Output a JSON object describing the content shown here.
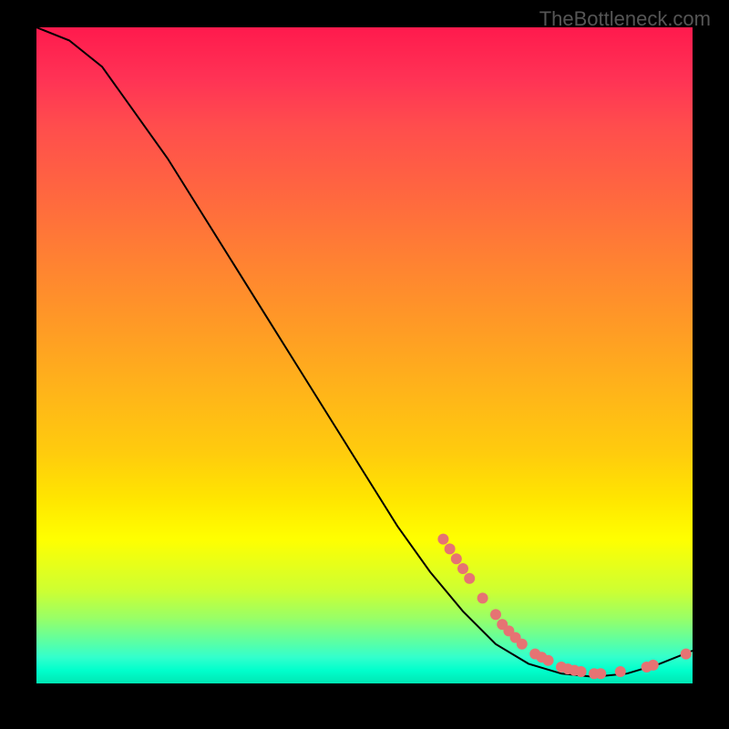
{
  "watermark": "TheBottleneck.com",
  "chart_data": {
    "type": "line",
    "title": "",
    "xlabel": "",
    "ylabel": "",
    "xlim": [
      0,
      100
    ],
    "ylim": [
      0,
      100
    ],
    "curve": [
      {
        "x": 0,
        "y": 100
      },
      {
        "x": 5,
        "y": 98
      },
      {
        "x": 10,
        "y": 94
      },
      {
        "x": 15,
        "y": 87
      },
      {
        "x": 20,
        "y": 80
      },
      {
        "x": 25,
        "y": 72
      },
      {
        "x": 30,
        "y": 64
      },
      {
        "x": 35,
        "y": 56
      },
      {
        "x": 40,
        "y": 48
      },
      {
        "x": 45,
        "y": 40
      },
      {
        "x": 50,
        "y": 32
      },
      {
        "x": 55,
        "y": 24
      },
      {
        "x": 60,
        "y": 17
      },
      {
        "x": 65,
        "y": 11
      },
      {
        "x": 70,
        "y": 6
      },
      {
        "x": 75,
        "y": 3
      },
      {
        "x": 80,
        "y": 1.5
      },
      {
        "x": 85,
        "y": 1
      },
      {
        "x": 90,
        "y": 1.5
      },
      {
        "x": 95,
        "y": 3
      },
      {
        "x": 100,
        "y": 5
      }
    ],
    "data_points": [
      {
        "x": 62,
        "y": 22
      },
      {
        "x": 63,
        "y": 20.5
      },
      {
        "x": 64,
        "y": 19
      },
      {
        "x": 65,
        "y": 17.5
      },
      {
        "x": 66,
        "y": 16
      },
      {
        "x": 68,
        "y": 13
      },
      {
        "x": 70,
        "y": 10.5
      },
      {
        "x": 71,
        "y": 9
      },
      {
        "x": 72,
        "y": 8
      },
      {
        "x": 73,
        "y": 7
      },
      {
        "x": 74,
        "y": 6
      },
      {
        "x": 76,
        "y": 4.5
      },
      {
        "x": 77,
        "y": 4
      },
      {
        "x": 78,
        "y": 3.5
      },
      {
        "x": 80,
        "y": 2.5
      },
      {
        "x": 81,
        "y": 2.2
      },
      {
        "x": 82,
        "y": 2
      },
      {
        "x": 83,
        "y": 1.8
      },
      {
        "x": 85,
        "y": 1.5
      },
      {
        "x": 86,
        "y": 1.5
      },
      {
        "x": 89,
        "y": 1.8
      },
      {
        "x": 93,
        "y": 2.5
      },
      {
        "x": 94,
        "y": 2.8
      },
      {
        "x": 99,
        "y": 4.5
      }
    ]
  }
}
